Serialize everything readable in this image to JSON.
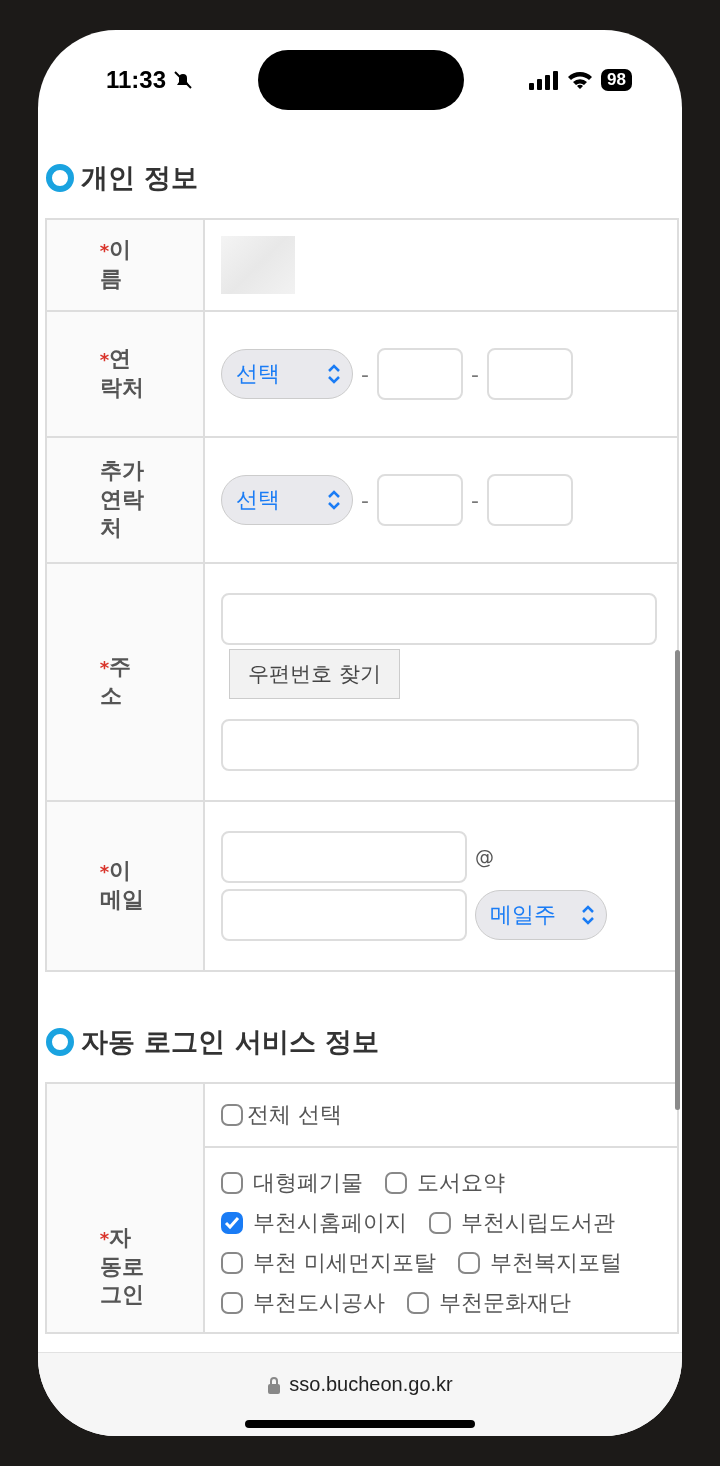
{
  "status_bar": {
    "time": "11:33",
    "battery": "98"
  },
  "sections": [
    {
      "title": "개인 정보",
      "rows": [
        {
          "kind": "name",
          "label": "이름",
          "required_mark": "*"
        },
        {
          "kind": "phone",
          "label": "연락처",
          "required_mark": "*",
          "select": "선택",
          "separators": [
            "-",
            "-"
          ]
        },
        {
          "kind": "phone",
          "label": "추가연락처",
          "select": "선택",
          "separators": [
            "-",
            "-"
          ]
        },
        {
          "kind": "address",
          "label": "주소",
          "required_mark": "*",
          "button": "우편번호 찾기"
        },
        {
          "kind": "email",
          "label": "이메일",
          "required_mark": "*",
          "at": "@",
          "select": "메일주"
        }
      ]
    },
    {
      "title": "자동 로그인 서비스 정보",
      "rows": [
        {
          "kind": "services",
          "label": "자동로그인",
          "required_mark": "*",
          "select_all": {
            "label": "전체 선택",
            "checked": false
          },
          "items": [
            {
              "label": "대형폐기물",
              "checked": false
            },
            {
              "label": "도서요약",
              "checked": false
            },
            {
              "label": "부천시홈페이지",
              "checked": true
            },
            {
              "label": "부천시립도서관",
              "checked": false
            },
            {
              "label": "부천 미세먼지포탈",
              "checked": false
            },
            {
              "label": "부천복지포털",
              "checked": false
            },
            {
              "label": "부천도시공사",
              "checked": false
            },
            {
              "label": "부천문화재단",
              "checked": false
            }
          ]
        }
      ]
    }
  ],
  "address_bar": {
    "url": "sso.bucheon.go.kr"
  }
}
